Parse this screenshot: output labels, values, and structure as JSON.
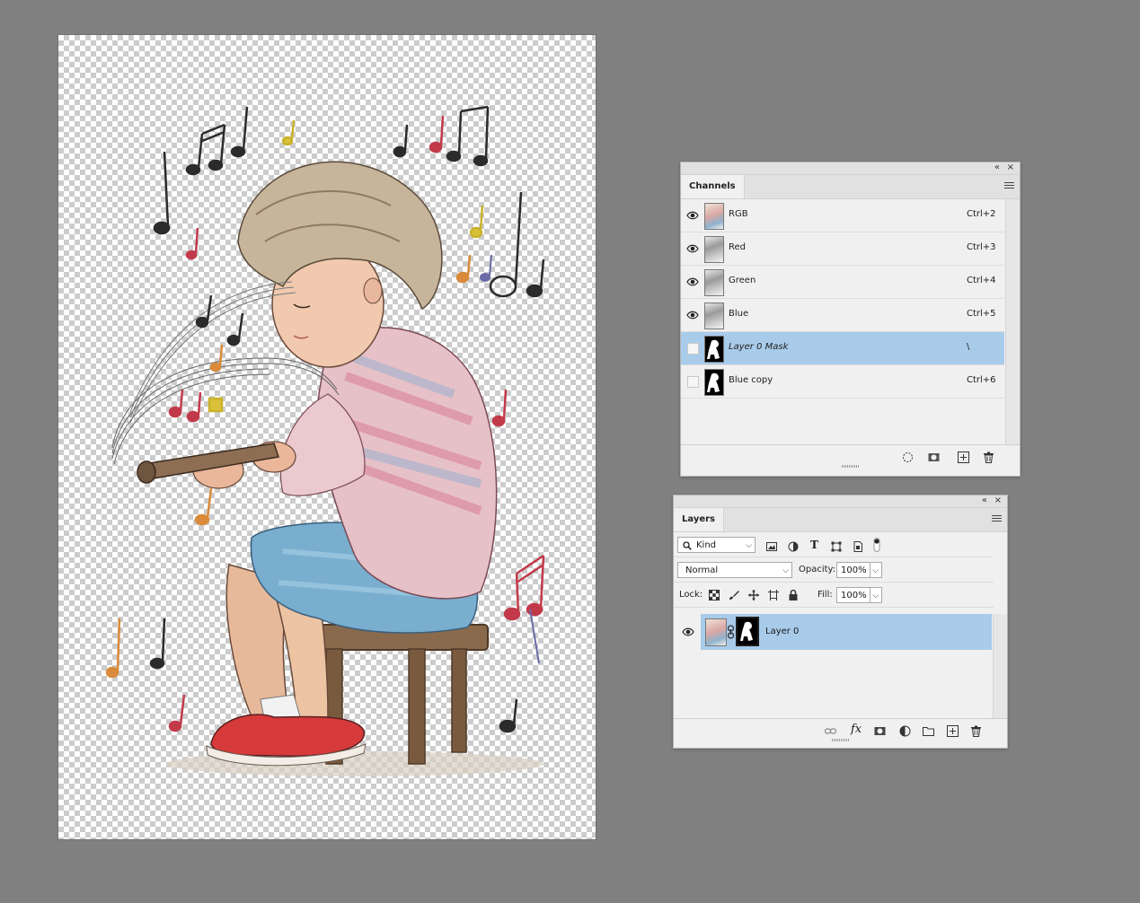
{
  "canvas": {
    "artwork": "child-playing-flute-illustration"
  },
  "channels_panel": {
    "tab_label": "Channels",
    "collapse_label": "«",
    "close_label": "×",
    "rows": [
      {
        "name": "RGB",
        "shortcut": "Ctrl+2",
        "visible": true,
        "selected": false,
        "italic": false
      },
      {
        "name": "Red",
        "shortcut": "Ctrl+3",
        "visible": true,
        "selected": false,
        "italic": false
      },
      {
        "name": "Green",
        "shortcut": "Ctrl+4",
        "visible": true,
        "selected": false,
        "italic": false
      },
      {
        "name": "Blue",
        "shortcut": "Ctrl+5",
        "visible": true,
        "selected": false,
        "italic": false
      },
      {
        "name": "Layer 0 Mask",
        "shortcut": "\\",
        "visible": false,
        "selected": true,
        "italic": true
      },
      {
        "name": "Blue copy",
        "shortcut": "Ctrl+6",
        "visible": false,
        "selected": false,
        "italic": false
      }
    ]
  },
  "layers_panel": {
    "tab_label": "Layers",
    "collapse_label": "«",
    "close_label": "×",
    "filter": {
      "value": "Kind"
    },
    "blend_mode": {
      "value": "Normal"
    },
    "opacity": {
      "label": "Opacity:",
      "value": "100%"
    },
    "lock": {
      "label": "Lock:"
    },
    "fill": {
      "label": "Fill:",
      "value": "100%"
    },
    "layers": [
      {
        "name": "Layer 0",
        "visible": true,
        "selected": true
      }
    ]
  },
  "colors": {
    "workspace": "#808080",
    "panel_bg": "#f0f0f0",
    "selection": "#a9cbea"
  }
}
